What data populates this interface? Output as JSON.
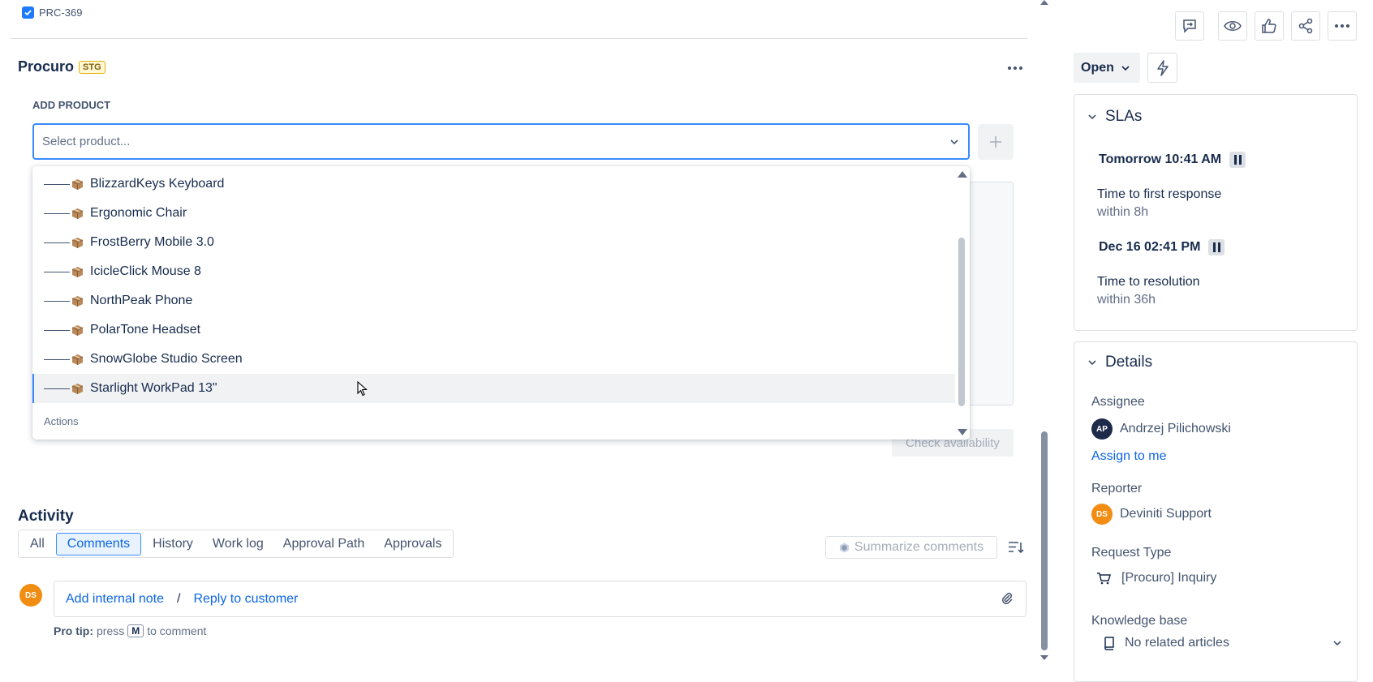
{
  "breadcrumb": {
    "issue_key": "PRC-369"
  },
  "app": {
    "name": "Procuro",
    "badge": "STG"
  },
  "add_product": {
    "label": "ADD PRODUCT",
    "placeholder": "Select product...",
    "options": [
      "BlizzardKeys Keyboard",
      "Ergonomic Chair",
      "FrostBerry Mobile 3.0",
      "IcicleClick Mouse 8",
      "NorthPeak Phone",
      "PolarTone Headset",
      "SnowGlobe Studio Screen",
      "Starlight WorkPad 13\""
    ],
    "highlighted_option": "Starlight WorkPad 13\"",
    "actions_label": "Actions",
    "check_label": "Check availability"
  },
  "activity": {
    "title": "Activity",
    "tabs": [
      "All",
      "Comments",
      "History",
      "Work log",
      "Approval Path",
      "Approvals"
    ],
    "active_tab": "Comments",
    "summarize_label": "Summarize comments",
    "add_note": "Add internal note",
    "separator": "/",
    "reply": "Reply to customer",
    "avatar_initials": "DS",
    "protip_prefix": "Pro tip:",
    "protip_press": "press",
    "protip_key": "M",
    "protip_suffix": "to comment"
  },
  "sidebar": {
    "status": "Open",
    "slas": {
      "title": "SLAs",
      "items": [
        {
          "date": "Tomorrow 10:41 AM",
          "name": "Time to first response",
          "within": "within 8h"
        },
        {
          "date": "Dec 16 02:41 PM",
          "name": "Time to resolution",
          "within": "within 36h"
        }
      ]
    },
    "details": {
      "title": "Details",
      "assignee_label": "Assignee",
      "assignee_initials": "AP",
      "assignee_name": "Andrzej Pilichowski",
      "assign_to_me": "Assign to me",
      "reporter_label": "Reporter",
      "reporter_initials": "DS",
      "reporter_name": "Deviniti Support",
      "request_type_label": "Request Type",
      "request_type": "[Procuro] Inquiry",
      "kb_label": "Knowledge base",
      "kb_value": "No related articles"
    }
  },
  "colors": {
    "accent": "#0c66e4",
    "focus": "#388bff",
    "avatar_orange": "#f18d13",
    "avatar_navy": "#1e2a4a"
  }
}
